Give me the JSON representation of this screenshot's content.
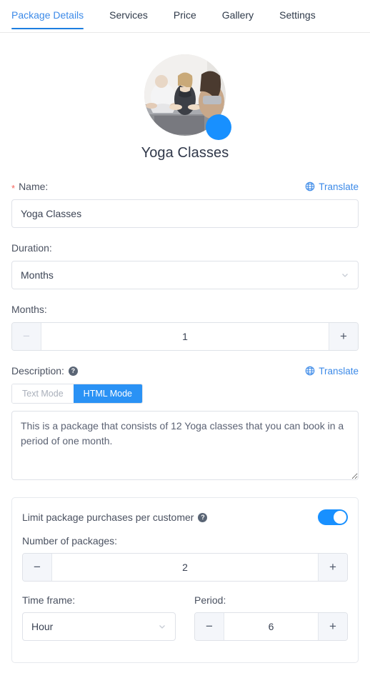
{
  "tabs": [
    {
      "label": "Package Details",
      "active": true
    },
    {
      "label": "Services",
      "active": false
    },
    {
      "label": "Price",
      "active": false
    },
    {
      "label": "Gallery",
      "active": false
    },
    {
      "label": "Settings",
      "active": false
    }
  ],
  "header": {
    "title": "Yoga Classes",
    "avatar_alt": "yoga-class-photo",
    "badge_icon": "edit-avatar-badge",
    "accent_color": "#1890ff"
  },
  "name_field": {
    "label": "Name:",
    "required_marker": "*",
    "value": "Yoga Classes",
    "placeholder": "",
    "translate_label": "Translate",
    "translate_icon": "globe-icon"
  },
  "duration_field": {
    "label": "Duration:",
    "value": "Months",
    "chevron_icon": "chevron-down-icon"
  },
  "months_field": {
    "label": "Months:",
    "value": "1",
    "minus_label": "−",
    "plus_label": "+",
    "minus_disabled": true
  },
  "description_field": {
    "label": "Description:",
    "help_icon": "question-mark-icon",
    "help_glyph": "?",
    "translate_label": "Translate",
    "translate_icon": "globe-icon",
    "modes": [
      {
        "label": "Text Mode",
        "active": false
      },
      {
        "label": "HTML Mode",
        "active": true
      }
    ],
    "value": "This is a package that consists of 12 Yoga classes that you can book in a period of one month.",
    "placeholder": ""
  },
  "limit_card": {
    "title": "Limit package purchases per customer",
    "help_icon": "question-mark-icon",
    "help_glyph": "?",
    "toggle_on": true,
    "number_of_packages": {
      "label": "Number of packages:",
      "value": "2",
      "minus_label": "−",
      "plus_label": "+"
    },
    "time_frame": {
      "label": "Time frame:",
      "value": "Hour",
      "chevron_icon": "chevron-down-icon"
    },
    "period": {
      "label": "Period:",
      "value": "6",
      "minus_label": "−",
      "plus_label": "+"
    }
  }
}
